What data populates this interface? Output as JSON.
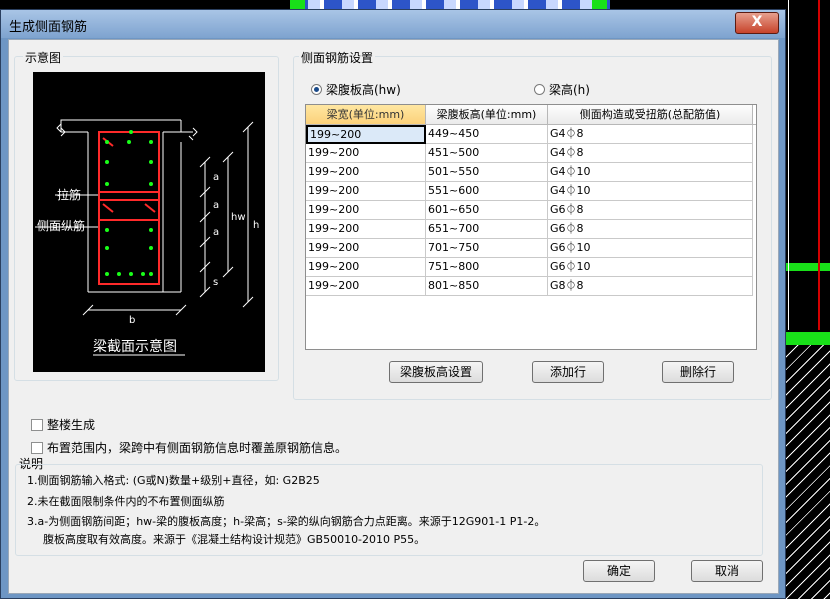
{
  "window": {
    "title": "生成侧面钢筋",
    "close_label": "X"
  },
  "diagram_group": {
    "label": "示意图",
    "caption": "梁截面示意图",
    "labels": {
      "tie": "拉筋",
      "side_bar": "侧面纵筋",
      "a": "a",
      "hw": "hw",
      "h": "h",
      "s": "s",
      "b": "b"
    }
  },
  "settings_group": {
    "label": "侧面钢筋设置",
    "radio_hw": "梁腹板高(hw)",
    "radio_h": "梁高(h)",
    "selected": "hw"
  },
  "table": {
    "columns": [
      "梁宽(单位:mm)",
      "梁腹板高(单位:mm)",
      "侧面构造或受扭筋(总配筋值)"
    ],
    "rows": [
      [
        "199~200",
        "449~450",
        "G4⏀8"
      ],
      [
        "199~200",
        "451~500",
        "G4⏀8"
      ],
      [
        "199~200",
        "501~550",
        "G4⏀10"
      ],
      [
        "199~200",
        "551~600",
        "G4⏀10"
      ],
      [
        "199~200",
        "601~650",
        "G6⏀8"
      ],
      [
        "199~200",
        "651~700",
        "G6⏀8"
      ],
      [
        "199~200",
        "701~750",
        "G6⏀10"
      ],
      [
        "199~200",
        "751~800",
        "G6⏀10"
      ],
      [
        "199~200",
        "801~850",
        "G8⏀8"
      ]
    ]
  },
  "buttons": {
    "web_height": "梁腹板高设置",
    "add_row": "添加行",
    "delete_row": "删除行",
    "ok": "确定",
    "cancel": "取消"
  },
  "options": {
    "whole_floor": "整楼生成",
    "override": "布置范围内，梁跨中有侧面钢筋信息时覆盖原钢筋信息。"
  },
  "notes": {
    "title": "说明",
    "line1": "1.侧面钢筋输入格式: (G或N)数量+级别+直径，如: G2B25",
    "line2": "2.未在截面限制条件内的不布置侧面纵筋",
    "line3": "3.a-为侧面钢筋间距；hw-梁的腹板高度；h-梁高；s-梁的纵向钢筋合力点距离。来源于12G901-1 P1-2。",
    "line4": "腹板高度取有效高度。来源于《混凝土结构设计规范》GB50010-2010 P55。"
  },
  "colors": {
    "highlight": "#fbd17a",
    "selection": "#dbe9f8",
    "bar": "#ff2a2a",
    "dot": "#19ff19"
  }
}
